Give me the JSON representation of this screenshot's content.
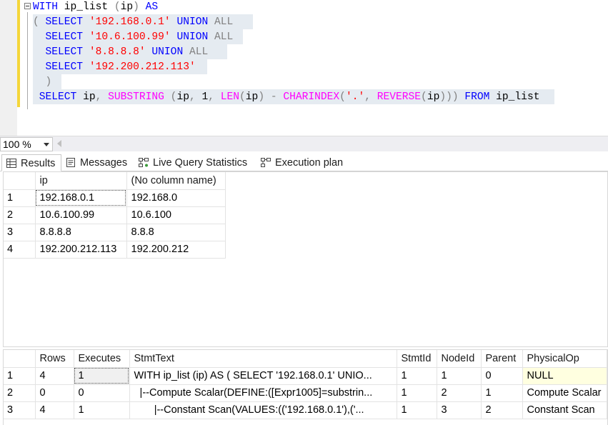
{
  "editor": {
    "lines": [
      [
        {
          "t": "WITH",
          "c": "kw"
        },
        {
          "t": " ip_list ",
          "c": "txt"
        },
        {
          "t": "(",
          "c": "gray"
        },
        {
          "t": "ip",
          "c": "txt"
        },
        {
          "t": ")",
          "c": "gray"
        },
        {
          "t": " AS",
          "c": "kw"
        }
      ],
      [
        {
          "t": "( ",
          "c": "gray"
        },
        {
          "t": "SELECT ",
          "c": "kw"
        },
        {
          "t": "'192.168.0.1'",
          "c": "str"
        },
        {
          "t": " UNION ",
          "c": "kw"
        },
        {
          "t": "ALL",
          "c": "gray"
        }
      ],
      [
        {
          "t": "  SELECT ",
          "c": "kw"
        },
        {
          "t": "'10.6.100.99'",
          "c": "str"
        },
        {
          "t": " UNION ",
          "c": "kw"
        },
        {
          "t": "ALL",
          "c": "gray"
        }
      ],
      [
        {
          "t": "  SELECT ",
          "c": "kw"
        },
        {
          "t": "'8.8.8.8'",
          "c": "str"
        },
        {
          "t": " UNION ",
          "c": "kw"
        },
        {
          "t": "ALL",
          "c": "gray"
        }
      ],
      [
        {
          "t": "  SELECT ",
          "c": "kw"
        },
        {
          "t": "'192.200.212.113'",
          "c": "str"
        }
      ],
      [
        {
          "t": "  )",
          "c": "gray"
        }
      ],
      [
        {
          "t": " SELECT ",
          "c": "kw"
        },
        {
          "t": "ip",
          "c": "txt"
        },
        {
          "t": ", ",
          "c": "gray"
        },
        {
          "t": "SUBSTRING ",
          "c": "fn"
        },
        {
          "t": "(",
          "c": "gray"
        },
        {
          "t": "ip",
          "c": "txt"
        },
        {
          "t": ", ",
          "c": "gray"
        },
        {
          "t": "1",
          "c": "txt"
        },
        {
          "t": ", ",
          "c": "gray"
        },
        {
          "t": "LEN",
          "c": "fn"
        },
        {
          "t": "(",
          "c": "gray"
        },
        {
          "t": "ip",
          "c": "txt"
        },
        {
          "t": ") - ",
          "c": "gray"
        },
        {
          "t": "CHARINDEX",
          "c": "fn"
        },
        {
          "t": "(",
          "c": "gray"
        },
        {
          "t": "'.'",
          "c": "str"
        },
        {
          "t": ", ",
          "c": "gray"
        },
        {
          "t": "REVERSE",
          "c": "fn"
        },
        {
          "t": "(",
          "c": "gray"
        },
        {
          "t": "ip",
          "c": "txt"
        },
        {
          "t": ")))",
          "c": "gray"
        },
        {
          "t": " FROM ",
          "c": "kw"
        },
        {
          "t": "ip_list",
          "c": "txt"
        }
      ]
    ]
  },
  "zoom": {
    "value": "100 %"
  },
  "tabs": [
    {
      "label": "Results",
      "icon": "grid-icon"
    },
    {
      "label": "Messages",
      "icon": "messages-icon"
    },
    {
      "label": "Live Query Statistics",
      "icon": "live-stats-icon"
    },
    {
      "label": "Execution plan",
      "icon": "execution-plan-icon"
    }
  ],
  "results": {
    "columns": [
      "ip",
      "(No column name)"
    ],
    "rows": [
      {
        "n": "1",
        "cells": [
          "192.168.0.1",
          "192.168.0"
        ]
      },
      {
        "n": "2",
        "cells": [
          "10.6.100.99",
          "10.6.100"
        ]
      },
      {
        "n": "3",
        "cells": [
          "8.8.8.8",
          "8.8.8"
        ]
      },
      {
        "n": "4",
        "cells": [
          "192.200.212.113",
          "192.200.212"
        ]
      }
    ]
  },
  "stats": {
    "columns": [
      "Rows",
      "Executes",
      "StmtText",
      "StmtId",
      "NodeId",
      "Parent",
      "PhysicalOp"
    ],
    "rows": [
      {
        "n": "1",
        "cells": [
          "4",
          "1",
          "WITH ip_list (ip) AS   ( SELECT '192.168.0.1' UNIO...",
          "1",
          "1",
          "0",
          "NULL"
        ]
      },
      {
        "n": "2",
        "cells": [
          "0",
          "0",
          "  |--Compute Scalar(DEFINE:([Expr1005]=substrin...",
          "1",
          "2",
          "1",
          "Compute Scalar"
        ]
      },
      {
        "n": "3",
        "cells": [
          "4",
          "1",
          "       |--Constant Scan(VALUES:(('192.168.0.1'),('...",
          "1",
          "3",
          "2",
          "Constant Scan"
        ]
      }
    ]
  }
}
